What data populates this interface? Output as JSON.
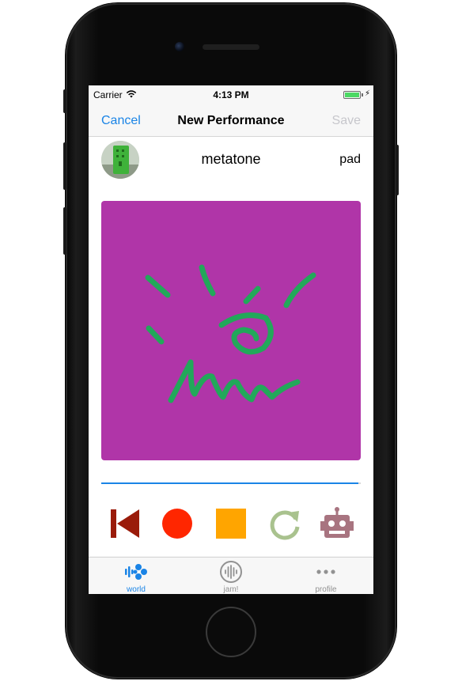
{
  "status_bar": {
    "carrier": "Carrier",
    "time": "4:13 PM",
    "battery_level": 1.0
  },
  "nav": {
    "cancel_label": "Cancel",
    "title": "New Performance",
    "save_label": "Save"
  },
  "performance": {
    "username": "metatone",
    "instrument": "pad",
    "progress": 0.99
  },
  "colors": {
    "accent": "#1a84e6",
    "canvas": "#b035a8",
    "stroke": "#22a85a",
    "record": "#ff2600",
    "stop": "#ffa500",
    "back": "#9a1b0a",
    "robot": "#a87480",
    "loop": "#a9c28e"
  },
  "controls": [
    {
      "name": "jump-to-start-icon"
    },
    {
      "name": "record-icon"
    },
    {
      "name": "stop-icon"
    },
    {
      "name": "loop-icon"
    },
    {
      "name": "robot-jam-icon"
    }
  ],
  "tabs": [
    {
      "label": "world",
      "icon": "world-icon",
      "active": true
    },
    {
      "label": "jam!",
      "icon": "jam-icon",
      "active": false
    },
    {
      "label": "profile",
      "icon": "more-icon",
      "active": false
    }
  ]
}
